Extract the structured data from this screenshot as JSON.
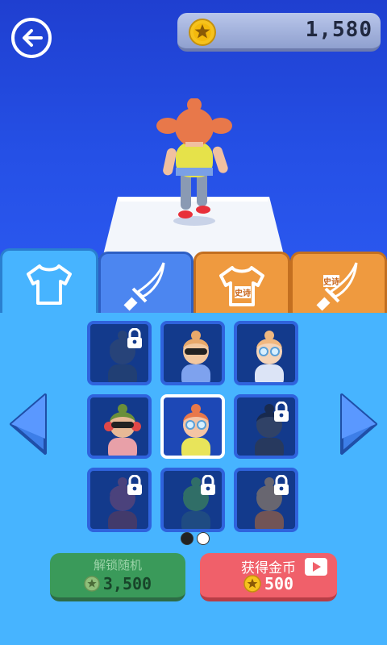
{
  "header": {
    "coins": "1,580"
  },
  "tabs": [
    {
      "name": "tab-shirts",
      "icon": "shirt-icon",
      "active": true
    },
    {
      "name": "tab-weapons",
      "icon": "sword-icon",
      "active": false
    },
    {
      "name": "tab-epic-shirts",
      "icon": "shirt-icon",
      "badge": "史诗",
      "active": false
    },
    {
      "name": "tab-epic-weapons",
      "icon": "sword-icon",
      "badge": "史诗",
      "active": false
    }
  ],
  "skins": [
    {
      "locked": true,
      "selected": false,
      "hair": "#3a4c6a",
      "skin": "#3a4c6a",
      "shirt": "#2e4462"
    },
    {
      "locked": false,
      "selected": false,
      "hair": "#e8a86a",
      "skin": "#f2c8a0",
      "shirt": "#7ea2ee",
      "glasses": "dark"
    },
    {
      "locked": false,
      "selected": false,
      "hair": "#f0b880",
      "skin": "#f4d4b8",
      "shirt": "#dce4f6",
      "glasses": "light"
    },
    {
      "locked": false,
      "selected": false,
      "hair": "#6a8f3a",
      "skin": "#e7b996",
      "shirt": "#e8a0a8",
      "glasses": "dark",
      "headphones": true
    },
    {
      "locked": false,
      "selected": true,
      "hair": "#e8784a",
      "skin": "#f4c4a4",
      "shirt": "#e8e45a",
      "glasses": "light"
    },
    {
      "locked": true,
      "selected": false,
      "hair": "#1e1e1e",
      "skin": "#4a4a4a",
      "shirt": "#3a3a3a"
    },
    {
      "locked": true,
      "selected": false,
      "hair": "#7a4a70",
      "skin": "#7a4a70",
      "shirt": "#6a3a50"
    },
    {
      "locked": true,
      "selected": false,
      "hair": "#4a9a4a",
      "skin": "#4a9a4a",
      "shirt": "#2a5a7a"
    },
    {
      "locked": true,
      "selected": false,
      "hair": "#b08a5a",
      "skin": "#b08a5a",
      "shirt": "#c06a2a"
    }
  ],
  "pagination": {
    "pages": 2,
    "current": 1
  },
  "unlock_random": {
    "label": "解锁随机",
    "price": "3,500"
  },
  "get_coins": {
    "label": "获得金币",
    "amount": "500"
  },
  "colors": {
    "accent_blue": "#47b4ff",
    "coin_gold": "#f6c21d",
    "button_green": "#3a9a5a",
    "button_red": "#f0606a"
  }
}
